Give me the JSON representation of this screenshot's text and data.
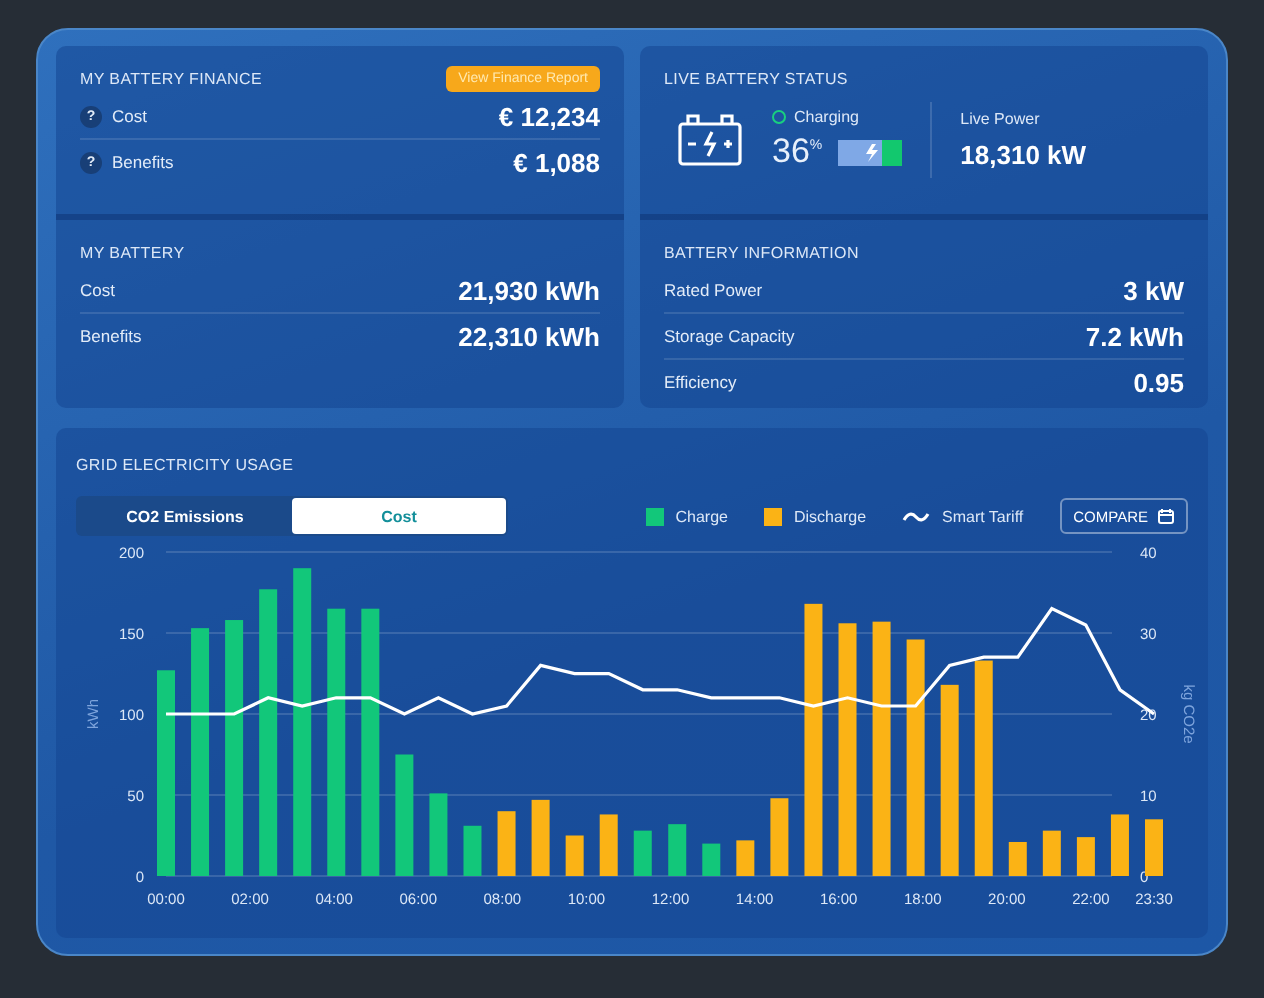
{
  "finance": {
    "title": "MY BATTERY FINANCE",
    "report_button": "View Finance Report",
    "rows": [
      {
        "icon": "?",
        "label": "Cost",
        "value": "€ 12,234"
      },
      {
        "icon": "?",
        "label": "Benefits",
        "value": "€ 1,088"
      }
    ]
  },
  "my_battery": {
    "title": "MY BATTERY",
    "rows": [
      {
        "label": "Cost",
        "value": "21,930 kWh"
      },
      {
        "label": "Benefits",
        "value": "22,310 kWh"
      }
    ]
  },
  "live_status": {
    "title": "LIVE BATTERY STATUS",
    "state": "Charging",
    "percent": "36",
    "percent_unit": "%",
    "live_power_label": "Live Power",
    "live_power": "18,310 kW"
  },
  "battery_info": {
    "title": "BATTERY INFORMATION",
    "rows": [
      {
        "label": "Rated Power",
        "value": "3 kW"
      },
      {
        "label": "Storage Capacity",
        "value": "7.2 kWh"
      },
      {
        "label": "Efficiency",
        "value": "0.95"
      }
    ]
  },
  "usage": {
    "title": "GRID ELECTRICITY USAGE",
    "toggle": [
      {
        "label": "CO2 Emissions",
        "selected": false
      },
      {
        "label": "Cost",
        "selected": true
      }
    ],
    "compare_button": "COMPARE",
    "chart_data": {
      "type": "bar",
      "ylabel": "kWh",
      "y2label": "kg CO2e",
      "ylim": [
        0,
        200
      ],
      "yticks": [
        0,
        50,
        100,
        150,
        200
      ],
      "y2lim": [
        0,
        40
      ],
      "y2ticks": [
        0,
        10,
        20,
        30,
        40
      ],
      "xlim": [
        0,
        23.5
      ],
      "x": [
        0,
        0.81,
        1.62,
        2.43,
        3.24,
        4.05,
        4.86,
        5.67,
        6.48,
        7.29,
        8.1,
        8.91,
        9.72,
        10.53,
        11.34,
        12.16,
        12.97,
        13.78,
        14.59,
        15.4,
        16.21,
        17.02,
        17.83,
        18.64,
        19.45,
        20.26,
        21.07,
        21.88,
        22.69,
        23.5
      ],
      "xticks": [
        {
          "value": 0,
          "label": "00:00"
        },
        {
          "value": 2,
          "label": "02:00"
        },
        {
          "value": 4,
          "label": "04:00"
        },
        {
          "value": 6,
          "label": "06:00"
        },
        {
          "value": 8,
          "label": "08:00"
        },
        {
          "value": 10,
          "label": "10:00"
        },
        {
          "value": 12,
          "label": "12:00"
        },
        {
          "value": 14,
          "label": "14:00"
        },
        {
          "value": 16,
          "label": "16:00"
        },
        {
          "value": 18,
          "label": "18:00"
        },
        {
          "value": 20,
          "label": "20:00"
        },
        {
          "value": 22,
          "label": "22:00"
        },
        {
          "value": 23.5,
          "label": "23:30"
        }
      ],
      "grid": true,
      "series": [
        {
          "name": "Charge",
          "color": "#12c77a",
          "values": [
            127,
            153,
            158,
            177,
            190,
            165,
            165,
            75,
            51,
            31,
            null,
            null,
            null,
            null,
            28,
            32,
            20,
            null,
            null,
            null,
            null,
            null,
            null,
            null,
            null,
            null,
            null,
            null,
            null,
            null
          ]
        },
        {
          "name": "Discharge",
          "color": "#fbb315",
          "values": [
            null,
            null,
            null,
            null,
            null,
            null,
            null,
            null,
            null,
            null,
            40,
            47,
            25,
            38,
            null,
            null,
            null,
            22,
            48,
            168,
            156,
            157,
            146,
            118,
            133,
            21,
            28,
            24,
            38,
            35
          ]
        },
        {
          "name": "Smart Tariff",
          "type": "line",
          "axis": "y2",
          "color": "#ffffff",
          "values": [
            20,
            20,
            20,
            22,
            21,
            22,
            22,
            20,
            22,
            20,
            21,
            26,
            25,
            25,
            23,
            23,
            22,
            22,
            22,
            21,
            22,
            21,
            21,
            26,
            27,
            27,
            33,
            31,
            23,
            20
          ]
        }
      ]
    }
  }
}
